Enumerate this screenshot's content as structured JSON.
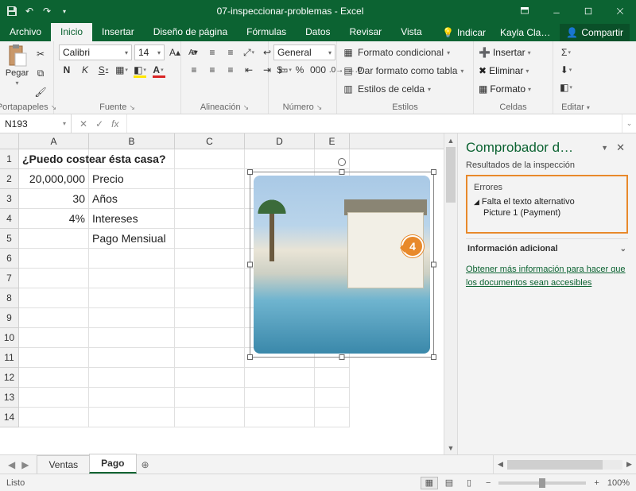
{
  "title": "07-inspeccionar-problemas - Excel",
  "tabs": {
    "archivo": "Archivo",
    "inicio": "Inicio",
    "insertar": "Insertar",
    "diseno": "Diseño de página",
    "formulas": "Fórmulas",
    "datos": "Datos",
    "revisar": "Revisar",
    "vista": "Vista",
    "tell": "Indicar",
    "user": "Kayla Cla…",
    "compartir": "Compartir"
  },
  "ribbon": {
    "portapapeles": {
      "label": "Portapapeles",
      "pegar": "Pegar"
    },
    "fuente": {
      "label": "Fuente",
      "font": "Calibri",
      "size": "14",
      "bold": "N",
      "italic": "K",
      "strike": "S"
    },
    "alineacion": {
      "label": "Alineación"
    },
    "numero": {
      "label": "Número",
      "format": "General"
    },
    "estilos": {
      "label": "Estilos",
      "condicional": "Formato condicional",
      "tabla": "Dar formato como tabla",
      "celda": "Estilos de celda"
    },
    "celdas": {
      "label": "Celdas",
      "insertar": "Insertar",
      "eliminar": "Eliminar",
      "formato": "Formato"
    },
    "editar": {
      "label": "Editar"
    }
  },
  "namebox": "N193",
  "fx_label": "fx",
  "columns": [
    "A",
    "B",
    "C",
    "D",
    "E"
  ],
  "rows": [
    "1",
    "2",
    "3",
    "4",
    "5",
    "6",
    "7",
    "8",
    "9",
    "10",
    "11",
    "12",
    "13",
    "14"
  ],
  "cells": {
    "a1": "¿Puedo costear ésta casa?",
    "a2": "20,000,000",
    "b2": "Precio",
    "a3": "30",
    "b3": "Años",
    "a4": "4%",
    "b4": "Intereses",
    "b5": "Pago Mensiual"
  },
  "callout": "4",
  "taskpane": {
    "title": "Comprobador d…",
    "subtitle": "Resultados de la inspección",
    "errors_hdr": "Errores",
    "err1": "Falta el texto alternativo",
    "err1_sub": "Picture 1 (Payment)",
    "info_hdr": "Información adicional",
    "link": "Obtener más información para hacer que los documentos sean accesibles"
  },
  "sheets": {
    "s1": "Ventas",
    "s2": "Pago"
  },
  "status": {
    "ready": "Listo",
    "zoom": "100%"
  }
}
